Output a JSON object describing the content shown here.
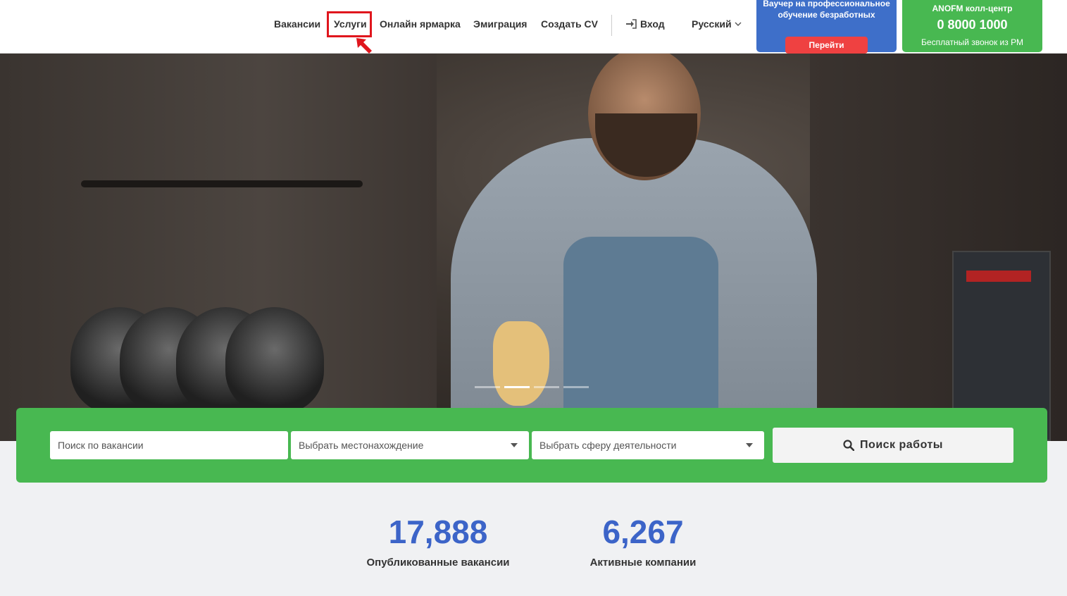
{
  "nav": {
    "items": [
      "Вакансии",
      "Услуги",
      "Онлайн ярмарка",
      "Эмиграция",
      "Создать CV"
    ],
    "highlighted": "Услуги",
    "login_label": "Вход",
    "language_label": "Русский"
  },
  "voucher": {
    "text": "Ваучер на профессиональное обучение безработных",
    "button_label": "Перейти"
  },
  "call_center": {
    "title": "ANOFM колл-центр",
    "phone": "0 8000 1000",
    "subtitle": "Бесплатный звонок из РМ"
  },
  "hero": {
    "slides_count": 4,
    "active_slide": 2
  },
  "search": {
    "query_placeholder": "Поиск по вакансии",
    "location_placeholder": "Выбрать местонахождение",
    "sector_placeholder": "Выбрать сферу деятельности",
    "button_label": "Поиск работы"
  },
  "stats": [
    {
      "value": "17,888",
      "label": "Опубликованные вакансии"
    },
    {
      "value": "6,267",
      "label": "Активные компании"
    }
  ],
  "colors": {
    "green": "#48b851",
    "blue": "#3e6fc9",
    "red": "#ef4141",
    "stat_blue": "#3c64c8",
    "highlight": "#e0161d"
  }
}
